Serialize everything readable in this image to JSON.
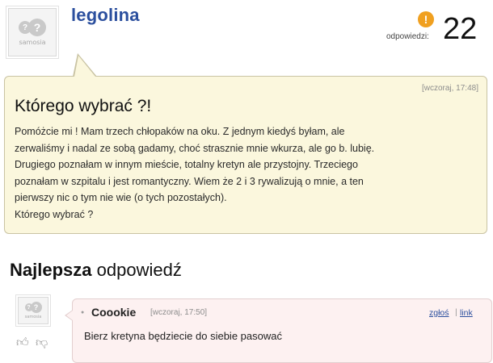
{
  "question": {
    "author": {
      "username": "legolina",
      "avatar_logo_text": "samosia",
      "avatar_icon": "question-bubbles-logo-icon"
    },
    "answers_label": "odpowiedzi:",
    "answers_count": "22",
    "answers_icon": "exclamation-badge-icon",
    "timestamp": "[wczoraj, 17:48]",
    "title": "Którego wybrać ?!",
    "body": "Pomóżcie mi ! Mam trzech chłopaków na oku. Z jednym kiedyś byłam, ale\nzerwaliśmy i nadal ze sobą gadamy, choć strasznie mnie wkurza, ale go b. lubię.\nDrugiego poznałam w innym mieście, totalny kretyn ale przystojny. Trzeciego\npoznałam w szpitalu i jest romantyczny. Wiem że 2 i 3 rywalizują o mnie, a ten\npierwszy nic o tym nie wie (o tych pozostałych).\nKtórego wybrać ?"
  },
  "best_answer": {
    "heading_bold": "Najlepsza",
    "heading_rest": "odpowiedź",
    "avatar_logo_text": "samosia",
    "author": "Coookie",
    "timestamp": "[wczoraj, 17:50]",
    "report_link": "zgłoś",
    "separator": "|",
    "link_link": "link",
    "text": "Bierz kretyna będziecie do siebie pasować",
    "vote_up_icon": "thumbs-up-icon",
    "vote_down_icon": "thumbs-down-icon"
  },
  "colors": {
    "username_blue": "#2b4f9e",
    "question_bg": "#fbf7dd",
    "answer_bg": "#fdf1f1",
    "badge_orange": "#f0a020"
  }
}
